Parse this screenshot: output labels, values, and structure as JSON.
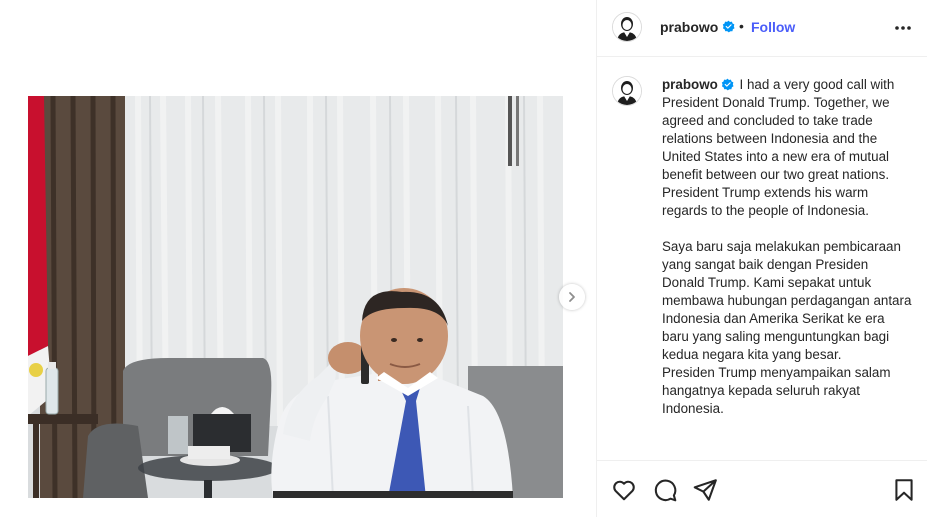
{
  "post": {
    "username": "prabowo",
    "verified": true,
    "separator": "•",
    "follow_label": "Follow"
  },
  "caption": {
    "username": "prabowo",
    "text": "I had a very good call with President Donald Trump. Together, we agreed and concluded to take trade relations between Indonesia and the United States into a new era of mutual benefit between our two great nations. President Trump extends his warm regards to the people of Indonesia.\n\nSaya baru saja melakukan pembicaraan yang sangat baik dengan Presiden Donald Trump. Kami sepakat untuk membawa hubungan perdagangan antara Indonesia dan Amerika Serikat ke era baru yang saling menguntungkan bagi kedua negara kita yang besar.\nPresiden Trump menyampaikan salam hangatnya kepada seluruh rakyat Indonesia."
  },
  "icons": {
    "verified": "verified-badge-icon",
    "more": "more-options-icon",
    "next": "chevron-right-icon",
    "like": "heart-icon",
    "comment": "comment-icon",
    "share": "paper-plane-icon",
    "save": "bookmark-icon"
  },
  "colors": {
    "accent": "#4a5df9",
    "verified": "#0095f6",
    "divider": "#efefef",
    "text": "#262626"
  }
}
